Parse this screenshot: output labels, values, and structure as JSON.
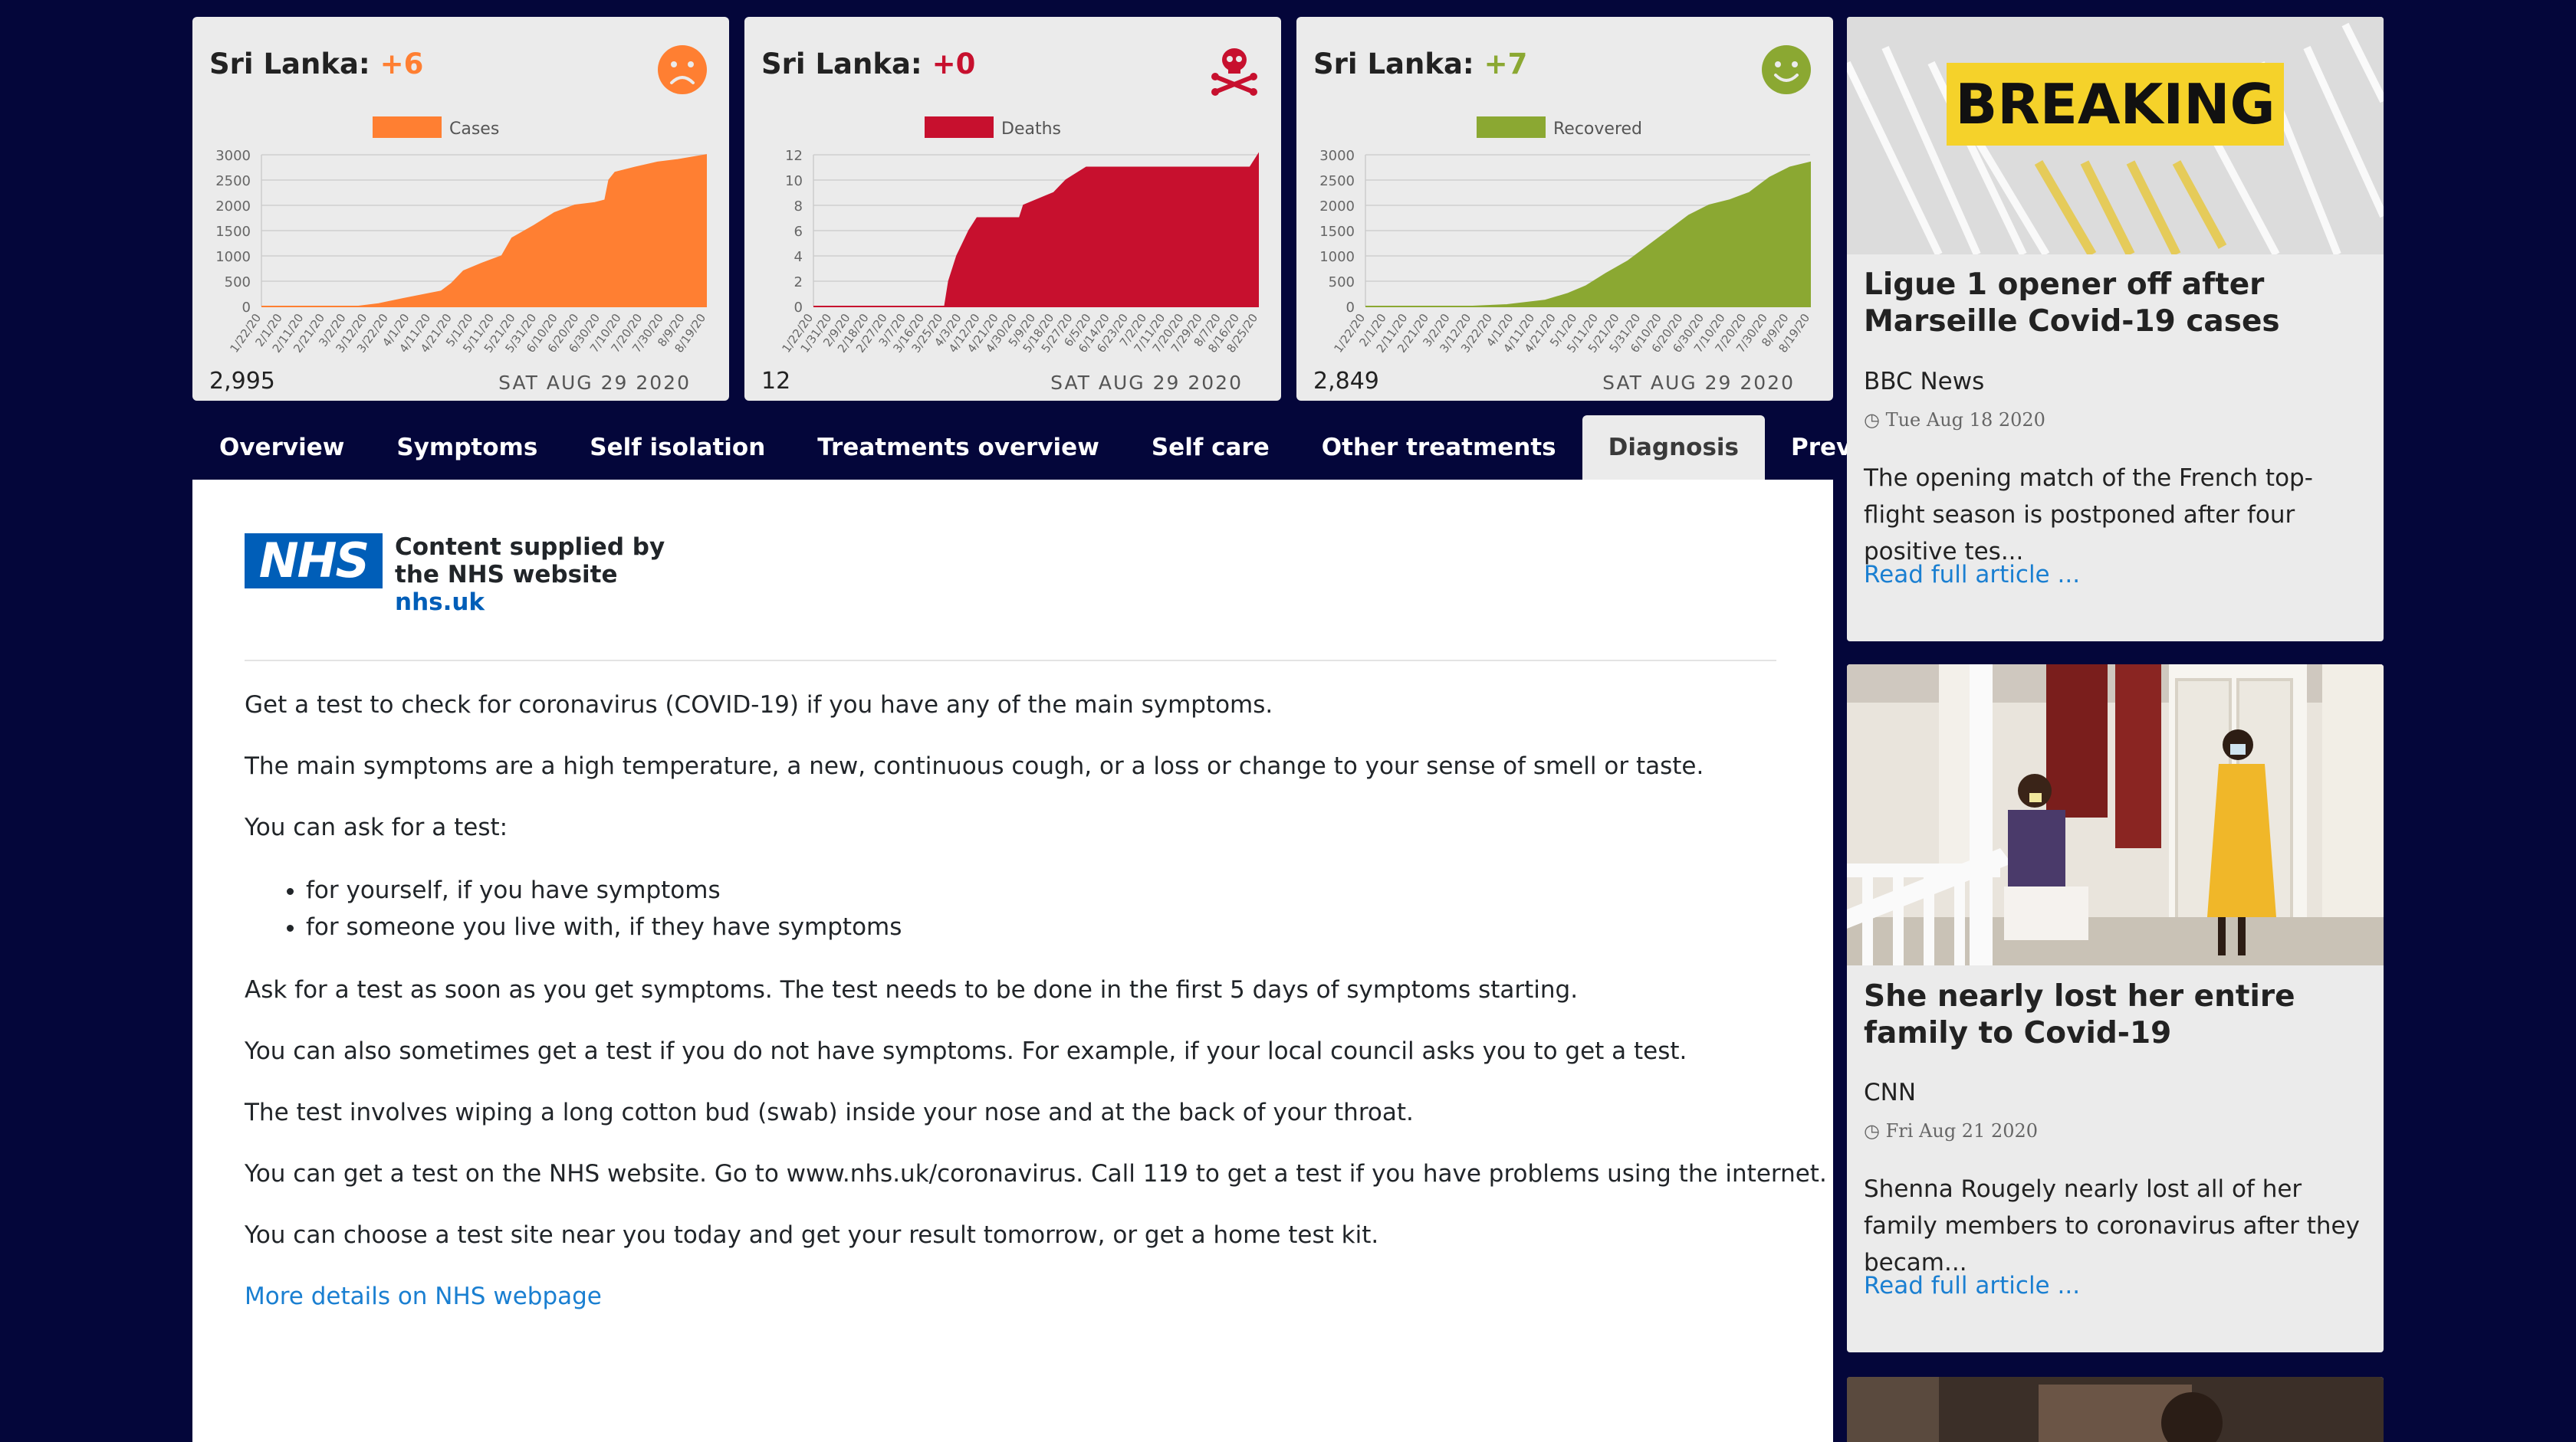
{
  "cards": [
    {
      "country": "Sri Lanka:",
      "delta": "+6",
      "color": "#ff7f32",
      "icon": "sad-face-icon",
      "legend": "Cases",
      "total": "2,995",
      "date": "SAT AUG 29 2020"
    },
    {
      "country": "Sri Lanka:",
      "delta": "+0",
      "color": "#c7102e",
      "icon": "skull-crossbones-icon",
      "legend": "Deaths",
      "total": "12",
      "date": "SAT AUG 29 2020"
    },
    {
      "country": "Sri Lanka:",
      "delta": "+7",
      "color": "#8ba832",
      "icon": "happy-face-icon",
      "legend": "Recovered",
      "total": "2,849",
      "date": "SAT AUG 29 2020"
    }
  ],
  "chart_data": [
    {
      "type": "area",
      "legend": "Cases",
      "color": "#ff7f32",
      "ylim": [
        0,
        3000
      ],
      "yticks": [
        0,
        500,
        1000,
        1500,
        2000,
        2500,
        3000
      ],
      "xticks": [
        "1/22/20",
        "2/1/20",
        "2/11/20",
        "2/21/20",
        "3/2/20",
        "3/12/20",
        "3/22/20",
        "4/1/20",
        "4/11/20",
        "4/21/20",
        "5/1/20",
        "5/11/20",
        "5/21/20",
        "5/31/20",
        "6/10/20",
        "6/20/20",
        "6/30/20",
        "7/10/20",
        "7/20/20",
        "7/30/20",
        "8/9/20",
        "8/19/20"
      ],
      "x": [
        "1/22/20",
        "3/10/20",
        "3/20/20",
        "4/1/20",
        "4/20/20",
        "4/25/20",
        "5/1/20",
        "5/10/20",
        "5/20/20",
        "5/25/20",
        "6/5/20",
        "6/15/20",
        "6/25/20",
        "7/5/20",
        "7/10/20",
        "7/12/20",
        "7/15/20",
        "7/25/20",
        "8/5/20",
        "8/15/20",
        "8/29/20"
      ],
      "y": [
        0,
        0,
        50,
        150,
        300,
        450,
        700,
        850,
        1000,
        1350,
        1600,
        1850,
        2000,
        2050,
        2100,
        2500,
        2650,
        2750,
        2850,
        2900,
        2995
      ]
    },
    {
      "type": "area",
      "legend": "Deaths",
      "color": "#c7102e",
      "ylim": [
        0,
        12
      ],
      "yticks": [
        0,
        2,
        4,
        6,
        8,
        10,
        12
      ],
      "xticks": [
        "1/22/20",
        "1/31/20",
        "2/9/20",
        "2/18/20",
        "2/27/20",
        "3/7/20",
        "3/16/20",
        "3/25/20",
        "4/3/20",
        "4/12/20",
        "4/21/20",
        "4/30/20",
        "5/9/20",
        "5/18/20",
        "5/27/20",
        "6/5/20",
        "6/14/20",
        "6/23/20",
        "7/2/20",
        "7/11/20",
        "7/20/20",
        "7/29/20",
        "8/7/20",
        "8/16/20",
        "8/25/20"
      ],
      "x": [
        "1/22/20",
        "3/27/20",
        "3/29/20",
        "3/31/20",
        "4/2/20",
        "4/5/20",
        "4/8/20",
        "4/12/20",
        "5/3/20",
        "5/5/20",
        "5/20/20",
        "5/26/20",
        "6/5/20",
        "8/25/20",
        "8/29/20"
      ],
      "y": [
        0,
        0,
        2,
        3,
        4,
        5,
        6,
        7,
        7,
        8,
        9,
        10,
        11,
        11,
        12
      ]
    },
    {
      "type": "area",
      "legend": "Recovered",
      "color": "#8ba832",
      "ylim": [
        0,
        3000
      ],
      "yticks": [
        0,
        500,
        1000,
        1500,
        2000,
        2500,
        3000
      ],
      "xticks": [
        "1/22/20",
        "2/1/20",
        "2/11/20",
        "2/21/20",
        "3/2/20",
        "3/12/20",
        "3/22/20",
        "4/1/20",
        "4/11/20",
        "4/21/20",
        "5/1/20",
        "5/11/20",
        "5/21/20",
        "5/31/20",
        "6/10/20",
        "6/20/20",
        "6/30/20",
        "7/10/20",
        "7/20/20",
        "7/30/20",
        "8/9/20",
        "8/19/20"
      ],
      "x": [
        "1/22/20",
        "3/15/20",
        "4/1/20",
        "4/20/20",
        "5/1/20",
        "5/10/20",
        "5/20/20",
        "5/31/20",
        "6/10/20",
        "6/20/20",
        "6/30/20",
        "7/10/20",
        "7/20/20",
        "7/30/20",
        "8/9/20",
        "8/19/20",
        "8/29/20"
      ],
      "y": [
        0,
        0,
        30,
        120,
        250,
        400,
        650,
        900,
        1200,
        1500,
        1800,
        2000,
        2100,
        2250,
        2550,
        2750,
        2849
      ]
    }
  ],
  "tabs": [
    "Overview",
    "Symptoms",
    "Self isolation",
    "Treatments overview",
    "Self care",
    "Other treatments",
    "Diagnosis",
    "Prevention"
  ],
  "active_tab": "Diagnosis",
  "nhs": {
    "logo": "NHS",
    "line1": "Content supplied by",
    "line2": "the NHS website",
    "link": "nhs.uk"
  },
  "content": {
    "p1": "Get a test to check for coronavirus (COVID-19) if you have any of the main symptoms.",
    "p2": "The main symptoms are a high temperature, a new, continuous cough, or a loss or change to your sense of smell or taste.",
    "p3": "You can ask for a test:",
    "bullets": [
      "for yourself, if you have symptoms",
      "for someone you live with, if they have symptoms"
    ],
    "p4": "Ask for a test as soon as you get symptoms. The test needs to be done in the first 5 days of symptoms starting.",
    "p5": "You can also sometimes get a test if you do not have symptoms. For example, if your local council asks you to get a test.",
    "p6": "The test involves wiping a long cotton bud (swab) inside your nose and at the back of your throat.",
    "p7": "You can get a test on the NHS website. Go to www.nhs.uk/coronavirus. Call 119 to get a test if you have problems using the internet.",
    "p8": "You can choose a test site near you today and get your result tomorrow, or get a home test kit.",
    "more_link": "More details on NHS webpage"
  },
  "news": [
    {
      "image_text": "BREAKING",
      "title": "Ligue 1 opener off after Marseille Covid-19 cases",
      "source": "BBC News",
      "date": "Tue Aug 18 2020",
      "summary": "The opening match of the French top-flight season is postponed after four positive tes...",
      "link": "Read full article ..."
    },
    {
      "title": "She nearly lost her entire family to Covid-19",
      "source": "CNN",
      "date": "Fri Aug 21 2020",
      "summary": "Shenna Rougely nearly lost all of her family members to coronavirus after they becam...",
      "link": "Read full article ..."
    }
  ]
}
